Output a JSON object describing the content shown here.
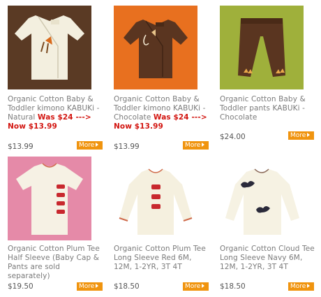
{
  "products": [
    {
      "title": "Organic Cotton Baby & Toddler kimono KABUKi - Natural",
      "was": "Was $24 --->",
      "now": "Now $13.99",
      "price": "$13.99",
      "more": "More",
      "image_bg": "#5a3a24",
      "image_name": "kimono-natural-image"
    },
    {
      "title": "Organic Cotton Baby & Toddler kimono KABUKi - Chocolate",
      "was": "Was $24 --->",
      "now": "Now $13.99",
      "price": "$13.99",
      "more": "More",
      "image_bg": "#e8701f",
      "image_name": "kimono-chocolate-image"
    },
    {
      "title": "Organic Cotton Baby & Toddler pants KABUKi - Chocolate",
      "price": "$24.00",
      "more": "More",
      "image_bg": "#9fb03b",
      "image_name": "pants-chocolate-image"
    },
    {
      "title": "Organic Cotton Plum Tee Half Sleeve (Baby Cap & Pants are sold separately)",
      "price": "$19.50",
      "more": "More",
      "image_bg": "#e58aa8",
      "image_name": "plum-tee-half-sleeve-image"
    },
    {
      "title": "Organic Cotton Plum Tee Long Sleeve Red 6M, 12M, 1-2YR, 3T 4T",
      "price": "$18.50",
      "more": "More",
      "image_bg": "#ffffff",
      "image_name": "plum-tee-long-sleeve-image"
    },
    {
      "title": "Organic Cotton Cloud Tee Long Sleeve Navy 6M, 12M, 1-2YR, 3T 4T",
      "price": "$18.50",
      "more": "More",
      "image_bg": "#ffffff",
      "image_name": "cloud-tee-long-sleeve-image"
    }
  ],
  "colors": {
    "sale_red": "#d2140f",
    "more_orange": "#f0940f",
    "title_grey": "#7a7a7a"
  }
}
